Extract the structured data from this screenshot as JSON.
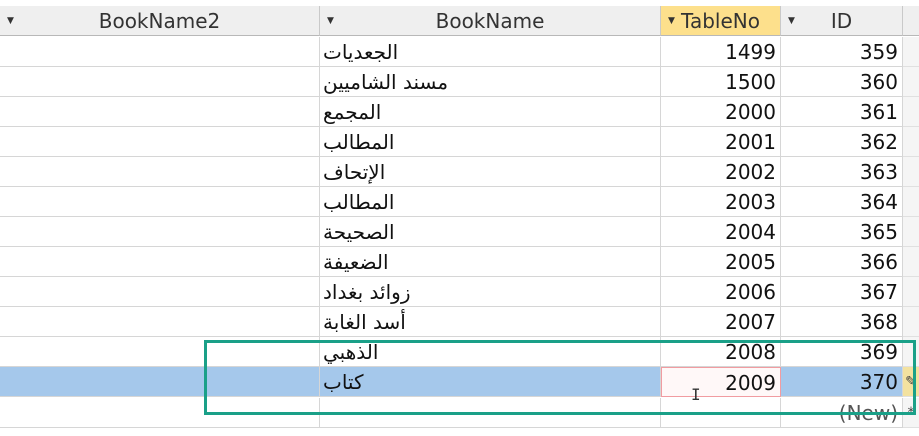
{
  "columns": {
    "bookname2": "BookName2",
    "bookname": "BookName",
    "tableno": "TableNo",
    "id": "ID"
  },
  "rows": [
    {
      "bookname": "الجعديات",
      "tableno": "1499",
      "id": "359"
    },
    {
      "bookname": "مسند الشاميين",
      "tableno": "1500",
      "id": "360"
    },
    {
      "bookname": "المجمع",
      "tableno": "2000",
      "id": "361"
    },
    {
      "bookname": "المطالب",
      "tableno": "2001",
      "id": "362"
    },
    {
      "bookname": "الإتحاف",
      "tableno": "2002",
      "id": "363"
    },
    {
      "bookname": "المطالب",
      "tableno": "2003",
      "id": "364"
    },
    {
      "bookname": "الصحيحة",
      "tableno": "2004",
      "id": "365"
    },
    {
      "bookname": "الضعيفة",
      "tableno": "2005",
      "id": "366"
    },
    {
      "bookname": "زوائد بغداد",
      "tableno": "2006",
      "id": "367"
    },
    {
      "bookname": "أسد الغابة",
      "tableno": "2007",
      "id": "368"
    },
    {
      "bookname": "الذهبي",
      "tableno": "2008",
      "id": "369"
    },
    {
      "bookname": "كتاب",
      "tableno": "2009",
      "id": "370"
    }
  ],
  "new_row": {
    "id": "(New)",
    "marker": "*"
  },
  "selected_row_index": 11,
  "colors": {
    "header_bg": "#efefef",
    "sorted_header_bg": "#fde08c",
    "selected_row": "#a5c8eb",
    "highlight_box": "#1aa088"
  }
}
